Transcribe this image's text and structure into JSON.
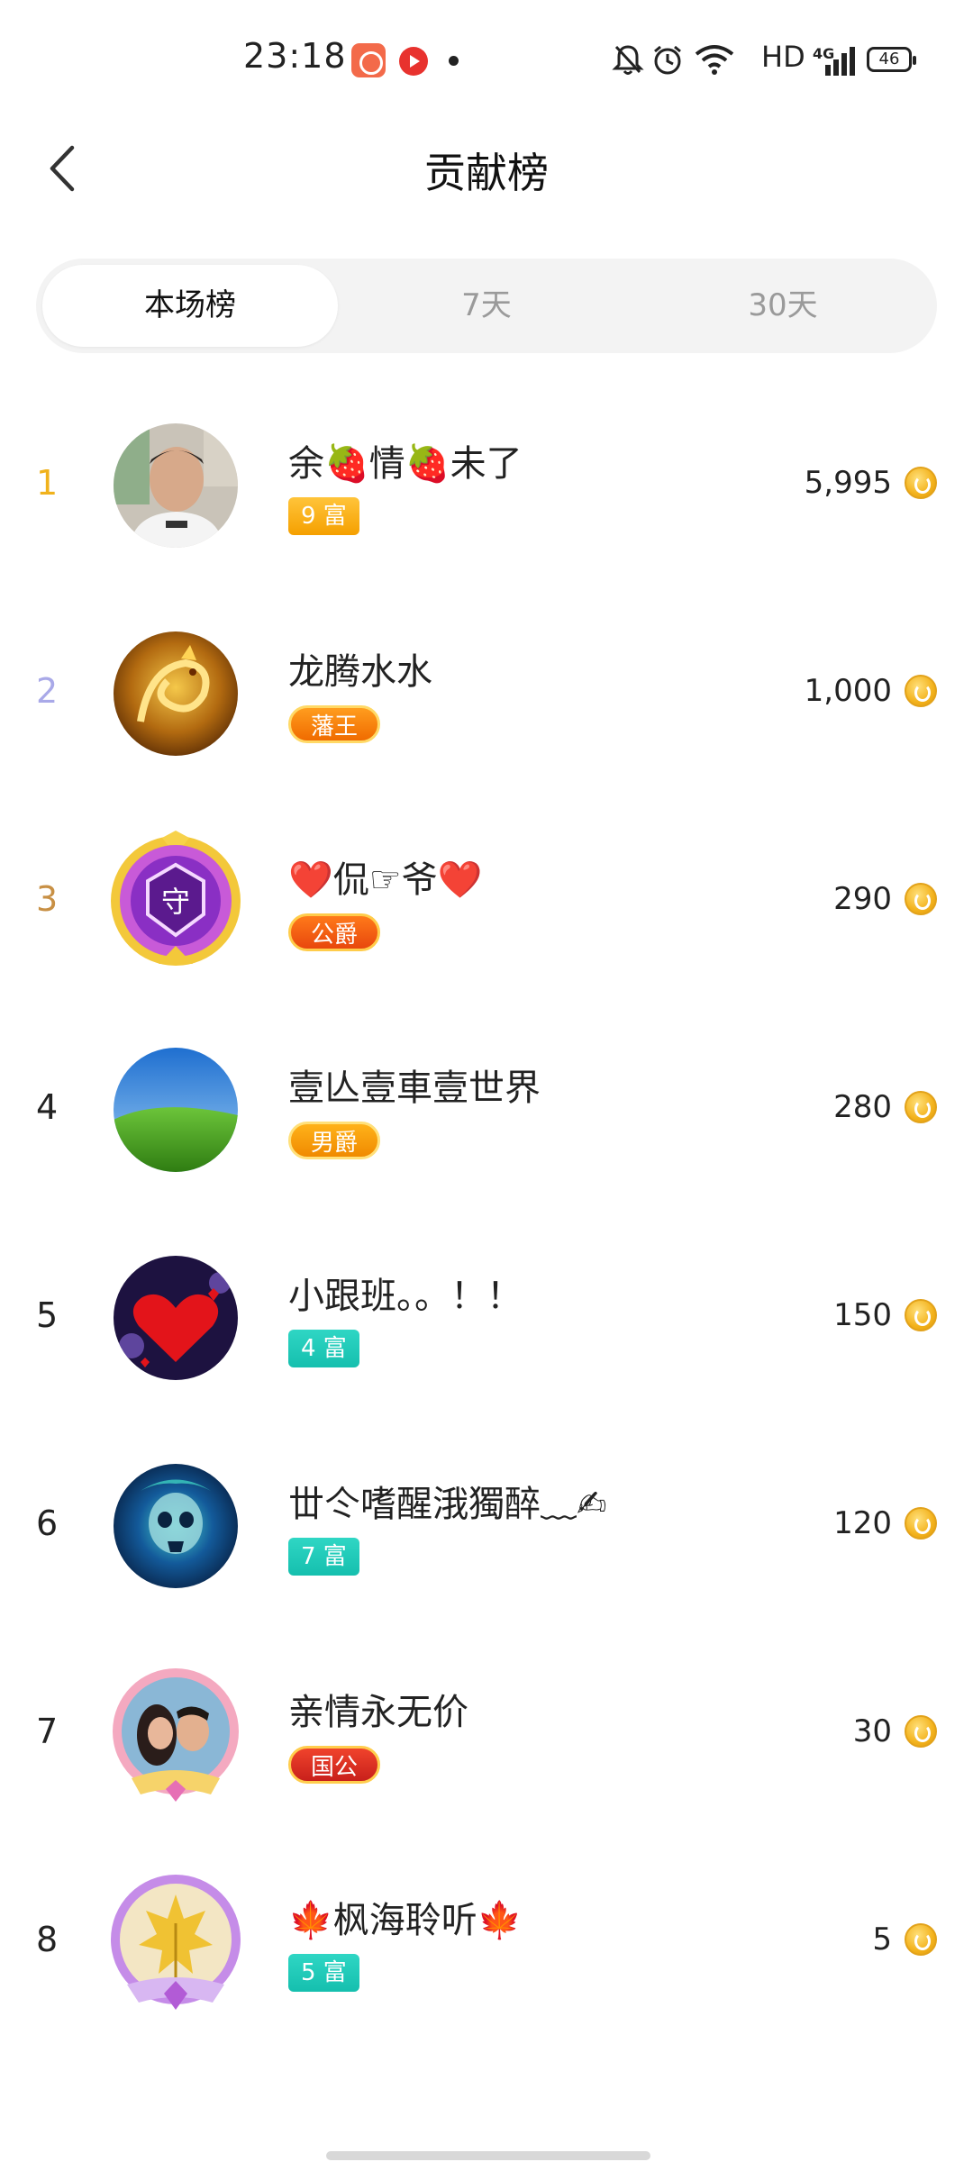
{
  "status_bar": {
    "time": "23:18",
    "network_label": "HD",
    "network_type": "4G",
    "battery": "46"
  },
  "header": {
    "title": "贡献榜",
    "back_icon": "chevron-left-icon"
  },
  "tabs": [
    {
      "label": "本场榜",
      "active": true
    },
    {
      "label": "7天",
      "active": false
    },
    {
      "label": "30天",
      "active": false
    }
  ],
  "colors": {
    "rank_1": "#f0b21c",
    "rank_2": "#a9a9e8",
    "rank_3": "#c89045",
    "rank_default": "#222222",
    "coin": "#f3b21c"
  },
  "ranking": [
    {
      "rank": "1",
      "name": "余🍓情🍓未了",
      "badge": "9 富",
      "badge_style": "gold",
      "score": "5,995",
      "avatar": "person-photo"
    },
    {
      "rank": "2",
      "name": "龙腾水水",
      "badge": "藩王",
      "badge_style": "king",
      "score": "1,000",
      "avatar": "golden-dragon"
    },
    {
      "rank": "3",
      "name": "❤️侃☞爷❤️",
      "badge": "公爵",
      "badge_style": "orange",
      "score": "290",
      "avatar": "guard-crest"
    },
    {
      "rank": "4",
      "name": "壹亾壹車壹世界",
      "badge": "男爵",
      "badge_style": "yellow",
      "score": "280",
      "avatar": "green-field"
    },
    {
      "rank": "5",
      "name": "小跟班。。！！",
      "badge": "4 富",
      "badge_style": "teal",
      "score": "150",
      "avatar": "red-heart"
    },
    {
      "rank": "6",
      "name": "丗仒嗜醒涐獨醉﹏✍",
      "badge": "7 富",
      "badge_style": "teal",
      "score": "120",
      "avatar": "blue-skull"
    },
    {
      "rank": "7",
      "name": "亲情永无价",
      "badge": "国公",
      "badge_style": "red",
      "score": "30",
      "avatar": "couple-photo"
    },
    {
      "rank": "8",
      "name": "🍁枫海聆听🍁",
      "badge": "5 富",
      "badge_style": "teal",
      "score": "5",
      "avatar": "maple-leaf"
    }
  ]
}
